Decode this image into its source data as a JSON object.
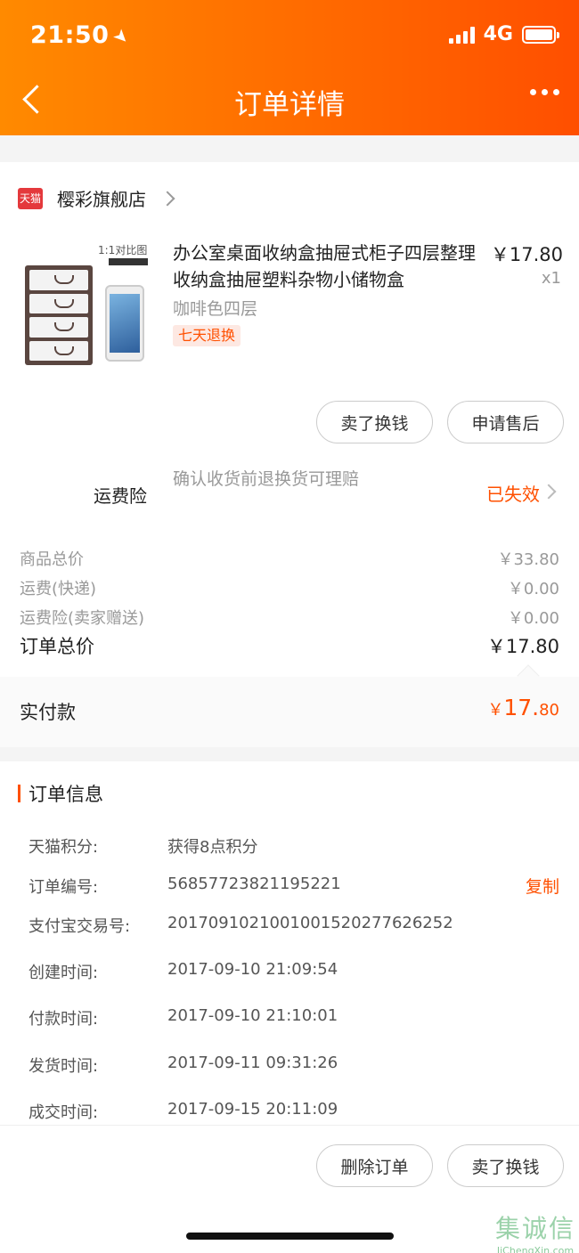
{
  "status_bar": {
    "time": "21:50",
    "network": "4G"
  },
  "nav": {
    "title": "订单详情"
  },
  "store": {
    "badge": "天猫",
    "name": "樱彩旗舰店"
  },
  "product": {
    "image_caption": "1:1对比图",
    "title": "办公室桌面收纳盒抽屉式柜子四层整理收纳盒抽屉塑料杂物小储物盒",
    "price": "￥17.80",
    "quantity": "x1",
    "variant": "咖啡色四层",
    "tag": "七天退换"
  },
  "item_actions": {
    "sell": "卖了换钱",
    "after_sale": "申请售后"
  },
  "freight_insurance": {
    "label": "运费险",
    "description": "确认收货前退换货可理赔",
    "status": "已失效"
  },
  "costs": [
    {
      "label": "商品总价",
      "value": "￥33.80"
    },
    {
      "label": "运费(快递)",
      "value": "￥0.00"
    },
    {
      "label": "运费险(卖家赠送)",
      "value": "￥0.00"
    }
  ],
  "order_total": {
    "label": "订单总价",
    "value": "￥17.80"
  },
  "paid": {
    "label": "实付款",
    "currency": "￥",
    "integer": "17.",
    "decimal": "80"
  },
  "order_info": {
    "title": "订单信息",
    "copy_label": "复制",
    "rows": [
      {
        "key": "天猫积分:",
        "value": "获得8点积分"
      },
      {
        "key": "订单编号:",
        "value": "56857723821195221"
      },
      {
        "key": "支付宝交易号:",
        "value": "2017091021001001520277626252"
      },
      {
        "key": "创建时间:",
        "value": "2017-09-10 21:09:54"
      },
      {
        "key": "付款时间:",
        "value": "2017-09-10 21:10:01"
      },
      {
        "key": "发货时间:",
        "value": "2017-09-11 09:31:26"
      },
      {
        "key": "成交时间:",
        "value": "2017-09-15 20:11:09"
      }
    ]
  },
  "bottom_actions": {
    "delete": "删除订单",
    "sell": "卖了换钱"
  },
  "watermark": {
    "chars": "集诚信",
    "url": "JiChengXin.com"
  },
  "colors": {
    "accent": "#ff5000",
    "header_start": "#ff8a00",
    "header_end": "#ff4f00"
  }
}
